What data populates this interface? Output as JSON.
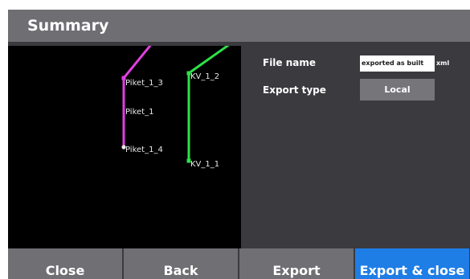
{
  "dialog": {
    "title": "Summary"
  },
  "preview": {
    "points": [
      {
        "id": "piket_1_3",
        "label": "Piket_1_3"
      },
      {
        "id": "piket_1",
        "label": "Piket_1"
      },
      {
        "id": "piket_1_4",
        "label": "Piket_1_4"
      },
      {
        "id": "kv_1_2",
        "label": "KV_1_2"
      },
      {
        "id": "kv_1_1",
        "label": "KV_1_1"
      }
    ],
    "colors": {
      "piket_line": "#e040e0",
      "kv_line": "#2ee04a",
      "background": "#000000"
    }
  },
  "form": {
    "file_name_label": "File name",
    "file_name_value": "exported as built",
    "file_name_extension": "xml",
    "export_type_label": "Export type",
    "export_type_value": "Local"
  },
  "buttons": {
    "close": "Close",
    "back": "Back",
    "export": "Export",
    "export_close": "Export & close"
  },
  "colors": {
    "titlebar": "#6e6e73",
    "panel": "#3a3a3f",
    "button": "#6f6f74",
    "primary_button": "#1e7ee6"
  }
}
